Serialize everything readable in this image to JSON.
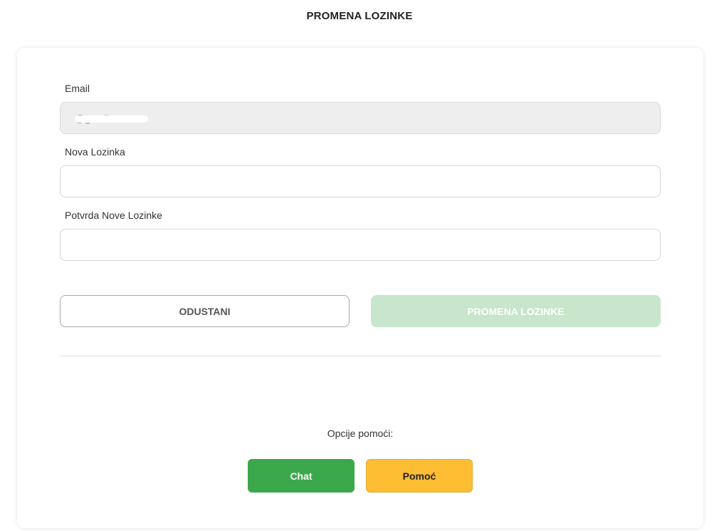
{
  "header": {
    "title": "PROMENA LOZINKE"
  },
  "form": {
    "email": {
      "label": "Email",
      "value": "@gmail.com"
    },
    "new_password": {
      "label": "Nova Lozinka",
      "value": "",
      "placeholder": ""
    },
    "confirm_password": {
      "label": "Potvrda Nove Lozinke",
      "value": "",
      "placeholder": ""
    }
  },
  "actions": {
    "cancel_label": "ODUSTANI",
    "submit_label": "PROMENA LOZINKE",
    "submit_disabled": true
  },
  "help": {
    "label": "Opcije pomoći:",
    "chat_label": "Chat",
    "help_label": "Pomoć"
  },
  "colors": {
    "chat": "#3ba94b",
    "help": "#fdbe33",
    "submit_disabled": "#c8e6cb",
    "input_disabled": "#eeeeee"
  }
}
